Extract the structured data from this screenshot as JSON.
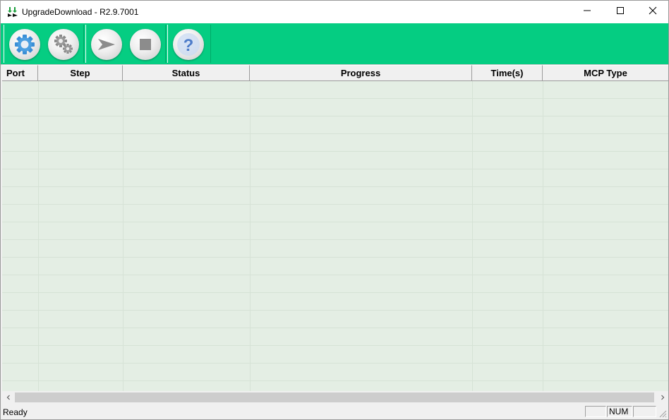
{
  "window": {
    "title": "UpgradeDownload - R2.9.7001",
    "icon": "download-arrows-icon"
  },
  "window_controls": {
    "minimize_icon": "minimize-icon",
    "maximize_icon": "maximize-icon",
    "close_icon": "close-icon"
  },
  "toolbar": {
    "background": "#05cd82",
    "buttons": [
      {
        "icon": "gear-icon"
      },
      {
        "icon": "gears-icon"
      },
      {
        "icon": "play-arrow-icon"
      },
      {
        "icon": "stop-icon"
      },
      {
        "icon": "help-icon"
      }
    ]
  },
  "list": {
    "columns": [
      "Port",
      "Step",
      "Status",
      "Progress",
      "Time(s)",
      "MCP Type"
    ],
    "rows": [],
    "row_background": "#e4eee4"
  },
  "scrollbar": {
    "left_icon": "chevron-left-icon",
    "right_icon": "chevron-right-icon"
  },
  "statusbar": {
    "text": "Ready",
    "panels": [
      "",
      "NUM",
      ""
    ]
  }
}
